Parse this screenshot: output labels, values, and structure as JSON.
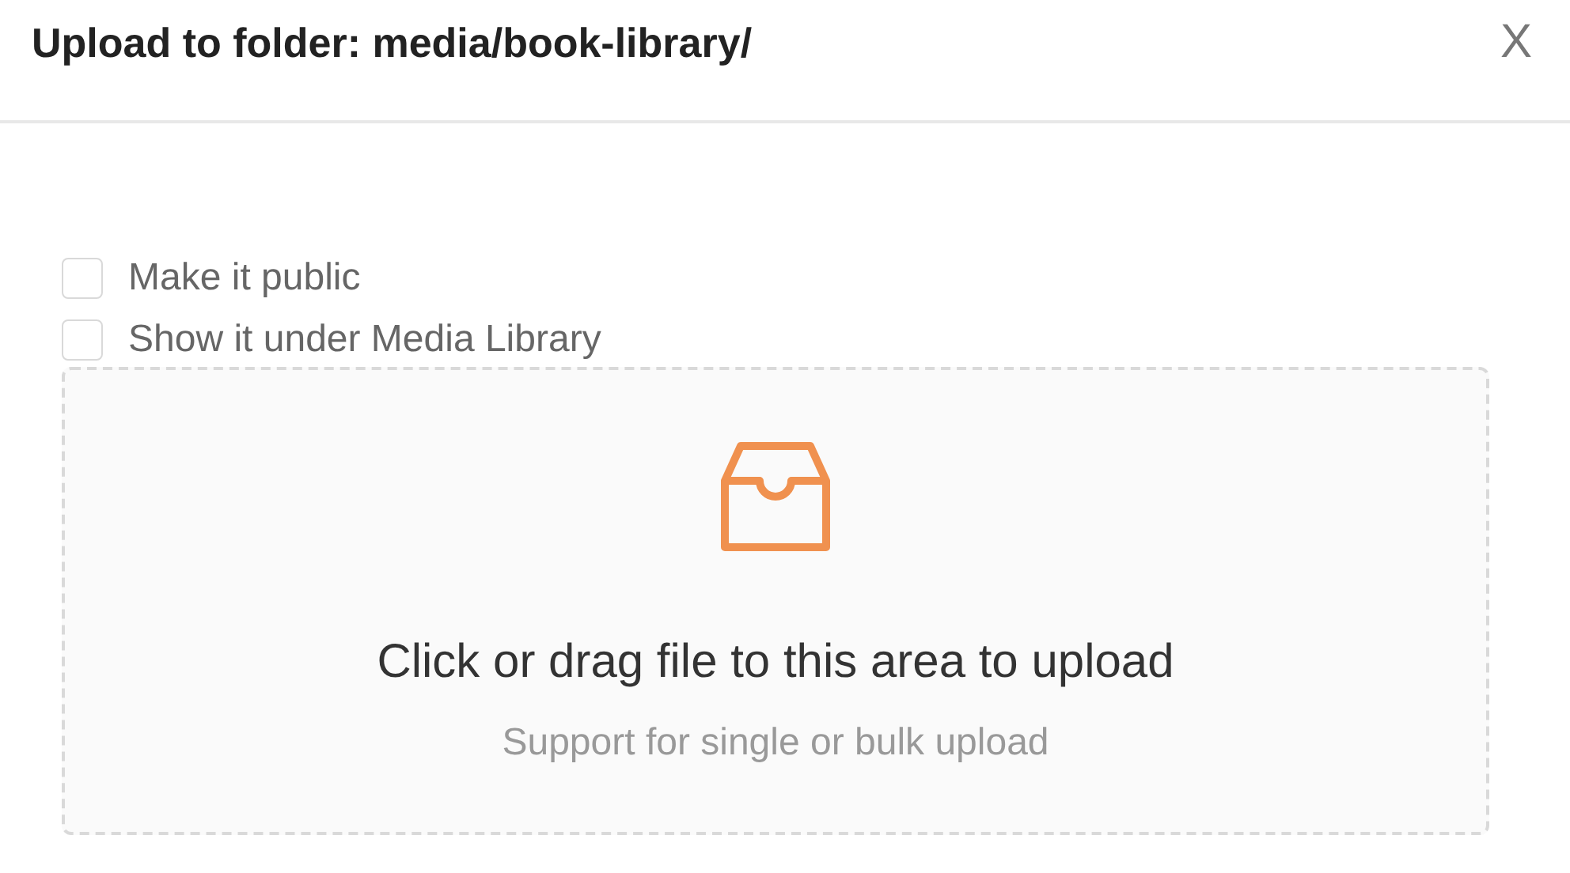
{
  "dialog": {
    "title": "Upload to folder: media/book-library/",
    "close": "X"
  },
  "options": [
    {
      "label": "Make it public",
      "checked": false
    },
    {
      "label": "Show it under Media Library",
      "checked": false
    }
  ],
  "dropzone": {
    "text": "Click or drag file to this area to upload",
    "hint": "Support for single or bulk upload"
  }
}
